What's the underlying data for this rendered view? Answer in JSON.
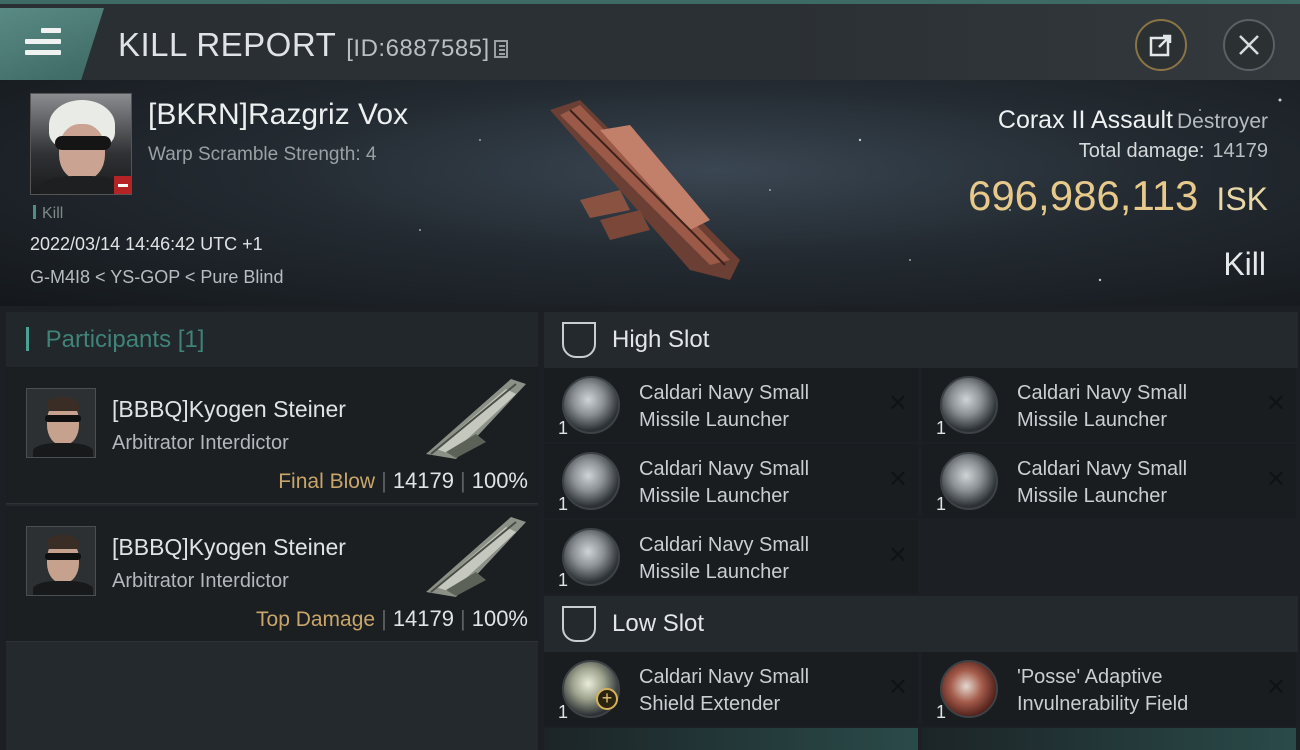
{
  "header": {
    "title": "KILL REPORT",
    "report_id": "[ID:6887585]",
    "icons": {
      "menu": "hamburger-menu-icon",
      "copy": "copy-icon",
      "share": "share-icon",
      "close": "close-icon"
    }
  },
  "victim": {
    "name": "[BKRN]Razgriz Vox",
    "subtitle": "Warp Scramble Strength: 4",
    "tag": "Kill",
    "datetime": "2022/03/14 14:46:42 UTC +1",
    "location": "G-M4I8 < YS-GOP < Pure Blind",
    "ship_name": "Corax II Assault",
    "ship_class": "Destroyer",
    "total_damage_label": "Total damage:",
    "total_damage": "14179",
    "isk_value": "696,986,113",
    "isk_unit": "ISK",
    "result": "Kill"
  },
  "participants": {
    "header": "Participants",
    "count": "[1]",
    "items": [
      {
        "name": "[BBBQ]Kyogen Steiner",
        "ship": "Arbitrator Interdictor",
        "tag": "Final Blow",
        "damage": "14179",
        "percent": "100%"
      },
      {
        "name": "[BBBQ]Kyogen Steiner",
        "ship": "Arbitrator Interdictor",
        "tag": "Top Damage",
        "damage": "14179",
        "percent": "100%"
      }
    ]
  },
  "slots": {
    "high": {
      "title": "High Slot",
      "modules": [
        {
          "line1": "Caldari Navy Small",
          "line2": "Missile Launcher",
          "qty": "1"
        },
        {
          "line1": "Caldari Navy Small",
          "line2": "Missile Launcher",
          "qty": "1"
        },
        {
          "line1": "Caldari Navy Small",
          "line2": "Missile Launcher",
          "qty": "1"
        },
        {
          "line1": "Caldari Navy Small",
          "line2": "Missile Launcher",
          "qty": "1"
        },
        {
          "line1": "Caldari Navy Small",
          "line2": "Missile Launcher",
          "qty": "1"
        }
      ]
    },
    "low": {
      "title": "Low Slot",
      "modules": [
        {
          "line1": "Caldari Navy Small",
          "line2": "Shield Extender",
          "qty": "1"
        },
        {
          "line1": "'Posse' Adaptive",
          "line2": "Invulnerability Field",
          "qty": "1"
        }
      ]
    }
  },
  "colors": {
    "accent_teal": "#4aa295",
    "isk_gold": "#e7c98b",
    "tag_gold": "#c9a56a",
    "badge_red": "#b52424"
  }
}
